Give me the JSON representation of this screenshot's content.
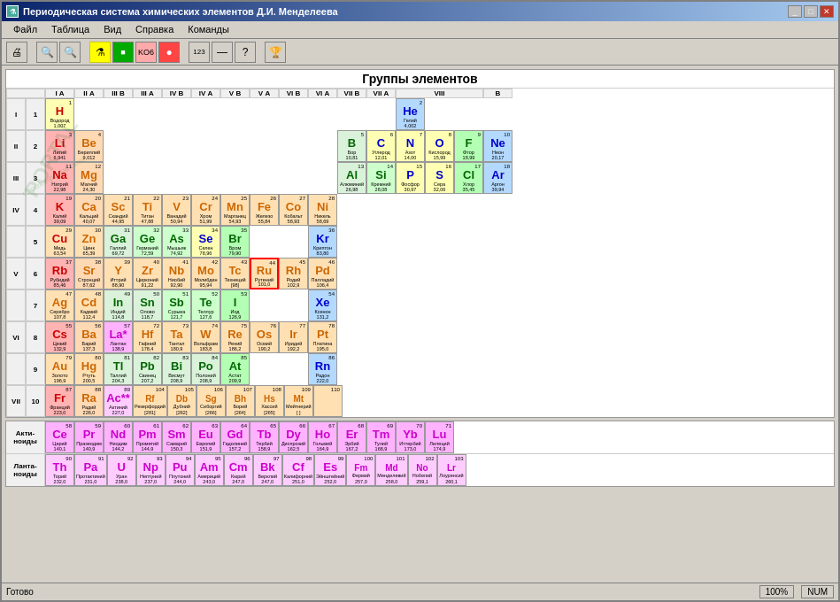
{
  "window": {
    "title": "Периодическая система химических элементов Д.И. Менделеева",
    "icon": "⚗"
  },
  "menu": {
    "items": [
      "Файл",
      "Таблица",
      "Вид",
      "Справка",
      "Команды"
    ]
  },
  "header": {
    "groups_title": "Группы элементов"
  },
  "statusbar": {
    "status": "Готово",
    "zoom": "100%",
    "numlock": "NUM"
  },
  "col_headers": {
    "ia": "I А",
    "iia": "II А",
    "iiib": "III B",
    "iiia": "III А",
    "ivb": "IV B",
    "iva": "IV А",
    "vb": "V B",
    "va": "V А",
    "vib": "VI B",
    "via": "VI А",
    "viib": "VII B",
    "viia": "VII А",
    "viii": "VIII",
    "b": "B"
  },
  "periods": {
    "labels": [
      "I",
      "II",
      "III",
      "IV",
      "IV",
      "V",
      "V",
      "VI",
      "VI",
      "VII"
    ]
  },
  "elements": {
    "H": {
      "num": 1,
      "symbol": "H",
      "name": "Водород",
      "mass": "1,007",
      "color": "hydrogen"
    },
    "He": {
      "num": 2,
      "symbol": "He",
      "name": "Гелий",
      "mass": "4,002",
      "color": "noble"
    },
    "Li": {
      "num": 3,
      "symbol": "Li",
      "name": "Литий",
      "mass": "6,941",
      "color": "alkali"
    },
    "Be": {
      "num": 4,
      "symbol": "Be",
      "name": "Бериллий",
      "mass": "9,012",
      "color": "alkaline"
    },
    "B": {
      "num": 5,
      "symbol": "B",
      "name": "Бор",
      "mass": "10,81",
      "color": "metalloid"
    },
    "C": {
      "num": 6,
      "symbol": "C",
      "name": "Углерод",
      "mass": "12,01",
      "color": "nonmetal"
    },
    "N": {
      "num": 7,
      "symbol": "N",
      "name": "Азот",
      "mass": "14,00",
      "color": "nonmetal"
    },
    "O": {
      "num": 8,
      "symbol": "O",
      "name": "Кислород",
      "mass": "15,99",
      "color": "nonmetal"
    },
    "F": {
      "num": 9,
      "symbol": "F",
      "name": "Фтор",
      "mass": "18,99",
      "color": "halogen"
    },
    "Ne": {
      "num": 10,
      "symbol": "Ne",
      "name": "Неон",
      "mass": "20,17",
      "color": "noble"
    },
    "Na": {
      "num": 11,
      "symbol": "Na",
      "name": "Натрий",
      "mass": "22,98",
      "color": "alkali"
    },
    "Mg": {
      "num": 12,
      "symbol": "Mg",
      "name": "Магний",
      "mass": "24,30",
      "color": "alkaline"
    },
    "Al": {
      "num": 13,
      "symbol": "Al",
      "name": "Алюминий",
      "mass": "26,98",
      "color": "post-transition"
    },
    "Si": {
      "num": 14,
      "symbol": "Si",
      "name": "Кремний",
      "mass": "28,08",
      "color": "metalloid"
    },
    "P": {
      "num": 15,
      "symbol": "P",
      "name": "Фосфор",
      "mass": "30,97",
      "color": "nonmetal"
    },
    "S": {
      "num": 16,
      "symbol": "S",
      "name": "Сера",
      "mass": "32,06",
      "color": "nonmetal"
    },
    "Cl": {
      "num": 17,
      "symbol": "Cl",
      "name": "Хлор",
      "mass": "35,45",
      "color": "halogen"
    },
    "Ar": {
      "num": 18,
      "symbol": "Ar",
      "name": "Аргон",
      "mass": "39,94",
      "color": "noble"
    },
    "K": {
      "num": 19,
      "symbol": "K",
      "name": "Калий",
      "mass": "39,09",
      "color": "alkali"
    },
    "Ca": {
      "num": 20,
      "symbol": "Ca",
      "name": "Кальций",
      "mass": "40,07",
      "color": "alkaline"
    },
    "Sc": {
      "num": 21,
      "symbol": "Sc",
      "name": "Скандий",
      "mass": "44,95",
      "color": "transition"
    },
    "Ti": {
      "num": 22,
      "symbol": "Ti",
      "name": "Титан",
      "mass": "47,88",
      "color": "transition"
    },
    "V": {
      "num": 23,
      "symbol": "V",
      "name": "Ванадий",
      "mass": "50,94",
      "color": "transition"
    },
    "Cr": {
      "num": 24,
      "symbol": "Cr",
      "name": "Хром",
      "mass": "51,99",
      "color": "transition"
    },
    "Mn": {
      "num": 25,
      "symbol": "Mn",
      "name": "Марганец",
      "mass": "54,93",
      "color": "transition"
    },
    "Fe": {
      "num": 26,
      "symbol": "Fe",
      "name": "Железо",
      "mass": "55,84",
      "color": "transition"
    },
    "Co": {
      "num": 27,
      "symbol": "Co",
      "name": "Кобальт",
      "mass": "58,93",
      "color": "transition"
    },
    "Ni": {
      "num": 28,
      "symbol": "Ni",
      "name": "Никель",
      "mass": "58,69",
      "color": "transition"
    },
    "Cu": {
      "num": 29,
      "symbol": "Cu",
      "name": "Медь",
      "mass": "63,54",
      "color": "transition"
    },
    "Zn": {
      "num": 30,
      "symbol": "Zn",
      "name": "Цинк",
      "mass": "65,39",
      "color": "transition"
    },
    "Ga": {
      "num": 31,
      "symbol": "Ga",
      "name": "Галлий",
      "mass": "69,72",
      "color": "post-transition"
    },
    "Ge": {
      "num": 32,
      "symbol": "Ge",
      "name": "Германий",
      "mass": "72,59",
      "color": "metalloid"
    },
    "As": {
      "num": 33,
      "symbol": "As",
      "name": "Мышьяк",
      "mass": "74,92",
      "color": "metalloid"
    },
    "Se": {
      "num": 34,
      "symbol": "Se",
      "name": "Селен",
      "mass": "78,96",
      "color": "nonmetal"
    },
    "Br": {
      "num": 35,
      "symbol": "Br",
      "name": "Бром",
      "mass": "79,90",
      "color": "halogen"
    },
    "Kr": {
      "num": 36,
      "symbol": "Kr",
      "name": "Криптон",
      "mass": "83,80",
      "color": "noble"
    },
    "Rb": {
      "num": 37,
      "symbol": "Rb",
      "name": "Рубидий",
      "mass": "85,46",
      "color": "alkali"
    },
    "Sr": {
      "num": 38,
      "symbol": "Sr",
      "name": "Стронций",
      "mass": "87,62",
      "color": "alkaline"
    },
    "Y": {
      "num": 39,
      "symbol": "Y",
      "name": "Иттрий",
      "mass": "88,90",
      "color": "transition"
    },
    "Zr": {
      "num": 40,
      "symbol": "Zr",
      "name": "Цирконий",
      "mass": "91,22",
      "color": "transition"
    },
    "Nb": {
      "num": 41,
      "symbol": "Nb",
      "name": "Ниобий",
      "mass": "92,90",
      "color": "transition"
    },
    "Mo": {
      "num": 42,
      "symbol": "Mo",
      "name": "Молибден",
      "mass": "95,94",
      "color": "transition"
    },
    "Tc": {
      "num": 43,
      "symbol": "Tc",
      "name": "Технеций",
      "mass": "[98]",
      "color": "transition"
    },
    "Ru": {
      "num": 44,
      "symbol": "Ru",
      "name": "Рутений",
      "mass": "101,0",
      "color": "transition"
    },
    "Rh": {
      "num": 45,
      "symbol": "Rh",
      "name": "Родий",
      "mass": "102,9",
      "color": "transition"
    },
    "Pd": {
      "num": 46,
      "symbol": "Pd",
      "name": "Палладий",
      "mass": "106,4",
      "color": "transition"
    },
    "Ag": {
      "num": 47,
      "symbol": "Ag",
      "name": "Серебро",
      "mass": "107,8",
      "color": "transition"
    },
    "Cd": {
      "num": 48,
      "symbol": "Cd",
      "name": "Кадмий",
      "mass": "112,4",
      "color": "transition"
    },
    "In": {
      "num": 49,
      "symbol": "In",
      "name": "Индий",
      "mass": "114,8",
      "color": "post-transition"
    },
    "Sn": {
      "num": 50,
      "symbol": "Sn",
      "name": "Олово",
      "mass": "118,7",
      "color": "post-transition"
    },
    "Sb": {
      "num": 51,
      "symbol": "Sb",
      "name": "Сурьма",
      "mass": "121,7",
      "color": "metalloid"
    },
    "Te": {
      "num": 52,
      "symbol": "Te",
      "name": "Теллур",
      "mass": "127,6",
      "color": "metalloid"
    },
    "I": {
      "num": 53,
      "symbol": "I",
      "name": "Иод",
      "mass": "126,9",
      "color": "halogen"
    },
    "Xe": {
      "num": 54,
      "symbol": "Xe",
      "name": "Ксенон",
      "mass": "131,2",
      "color": "noble"
    },
    "Cs": {
      "num": 55,
      "symbol": "Cs",
      "name": "Цезий",
      "mass": "132,9",
      "color": "alkali"
    },
    "Ba": {
      "num": 56,
      "symbol": "Ba",
      "name": "Барий",
      "mass": "137,3",
      "color": "alkaline"
    },
    "La": {
      "num": 57,
      "symbol": "La*",
      "name": "Лантан",
      "mass": "138,9",
      "color": "lanthanide"
    },
    "Hf": {
      "num": 72,
      "symbol": "Hf",
      "name": "Гафний",
      "mass": "178,4",
      "color": "transition"
    },
    "Ta": {
      "num": 73,
      "symbol": "Ta",
      "name": "Тантал",
      "mass": "180,9",
      "color": "transition"
    },
    "W": {
      "num": 74,
      "symbol": "W",
      "name": "Вольфрам",
      "mass": "183,8",
      "color": "transition"
    },
    "Re": {
      "num": 75,
      "symbol": "Re",
      "name": "Рений",
      "mass": "186,2",
      "color": "transition"
    },
    "Os": {
      "num": 76,
      "symbol": "Os",
      "name": "Осмий",
      "mass": "190,2",
      "color": "transition"
    },
    "Ir": {
      "num": 77,
      "symbol": "Ir",
      "name": "Иридий",
      "mass": "192,2",
      "color": "transition"
    },
    "Pt": {
      "num": 78,
      "symbol": "Pt",
      "name": "Платина",
      "mass": "195,0",
      "color": "transition"
    },
    "Au": {
      "num": 79,
      "symbol": "Au",
      "name": "Золото",
      "mass": "196,9",
      "color": "transition"
    },
    "Hg": {
      "num": 80,
      "symbol": "Hg",
      "name": "Ртуть",
      "mass": "200,5",
      "color": "transition"
    },
    "Tl": {
      "num": 81,
      "symbol": "Tl",
      "name": "Таллий",
      "mass": "204,3",
      "color": "post-transition"
    },
    "Pb": {
      "num": 82,
      "symbol": "Pb",
      "name": "Свинец",
      "mass": "207,2",
      "color": "post-transition"
    },
    "Bi": {
      "num": 83,
      "symbol": "Bi",
      "name": "Висмут",
      "mass": "208,9",
      "color": "post-transition"
    },
    "Po": {
      "num": 84,
      "symbol": "Po",
      "name": "Полоний",
      "mass": "208,9",
      "color": "post-transition"
    },
    "At": {
      "num": 85,
      "symbol": "At",
      "name": "Астат",
      "mass": "209,9",
      "color": "halogen"
    },
    "Rn": {
      "num": 86,
      "symbol": "Rn",
      "name": "Радон",
      "mass": "222,0",
      "color": "noble"
    },
    "Fr": {
      "num": 87,
      "symbol": "Fr",
      "name": "Франций",
      "mass": "223,0",
      "color": "alkali"
    },
    "Ra": {
      "num": 88,
      "symbol": "Ra",
      "name": "Радий",
      "mass": "226,0",
      "color": "alkaline"
    },
    "Ac": {
      "num": 89,
      "symbol": "Ac**",
      "name": "Актиний",
      "mass": "227,0",
      "color": "actinide"
    },
    "Rf": {
      "num": 104,
      "symbol": "Rf",
      "name": "Резерфордий",
      "mass": "[281]",
      "color": "transition"
    },
    "Db": {
      "num": 105,
      "symbol": "Db",
      "name": "Дубний",
      "mass": "[262]",
      "color": "transition"
    },
    "Sg": {
      "num": 106,
      "symbol": "Sg",
      "name": "Сиборгий",
      "mass": "[266]",
      "color": "transition"
    },
    "Bh": {
      "num": 107,
      "symbol": "Bh",
      "name": "Борий",
      "mass": "[264]",
      "color": "transition"
    },
    "Hs": {
      "num": 108,
      "symbol": "Hs",
      "name": "Хассий",
      "mass": "[265]",
      "color": "transition"
    },
    "Mt": {
      "num": 109,
      "symbol": "Mt",
      "name": "Мейтнерий",
      "mass": "[ ]",
      "color": "transition"
    },
    "110": {
      "num": 110,
      "symbol": "110",
      "name": "",
      "mass": "",
      "color": "transition"
    }
  }
}
